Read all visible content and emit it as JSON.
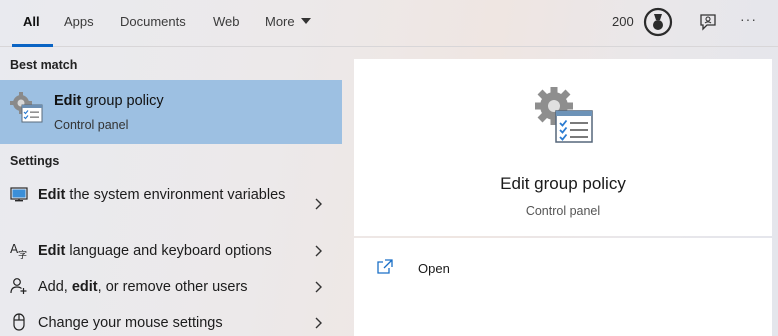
{
  "nav": {
    "tabs": [
      {
        "label": "All",
        "active": true
      },
      {
        "label": "Apps"
      },
      {
        "label": "Documents"
      },
      {
        "label": "Web"
      },
      {
        "label": "More"
      }
    ],
    "points": "200",
    "icons": [
      "medal-icon",
      "feedback-icon",
      "more-options-icon"
    ],
    "more_options": "···"
  },
  "left": {
    "best_match_header": "Best match",
    "best_match": {
      "title_bold": "Edit",
      "title_rest": " group policy",
      "subtitle": "Control panel",
      "icon": "group-policy-icon"
    },
    "settings_header": "Settings",
    "settings": [
      {
        "bold": "Edit",
        "pre": "",
        "rest": " the system environment variables",
        "icon": "monitor-icon"
      },
      {
        "bold": "Edit",
        "pre": "",
        "rest": " language and keyboard options",
        "icon": "language-icon"
      },
      {
        "bold": "edit",
        "pre": "Add, ",
        "rest": ", or remove other users",
        "icon": "add-user-icon"
      },
      {
        "bold": "",
        "pre": "Change your mouse settings",
        "rest": "",
        "icon": "mouse-icon"
      }
    ]
  },
  "right": {
    "title": "Edit group policy",
    "subtitle": "Control panel",
    "actions": [
      {
        "label": "Open",
        "icon": "open-icon"
      }
    ]
  },
  "colors": {
    "accent": "#0a64c4",
    "selected_bg": "#9dc0e2"
  }
}
